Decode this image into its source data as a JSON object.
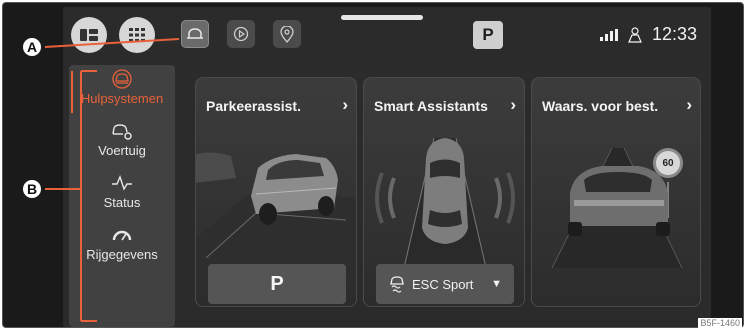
{
  "topbar": {
    "gear": "P",
    "clock": "12:33",
    "icons": [
      "display-icon",
      "grid-icon",
      "car-assist-icon",
      "media-play-icon",
      "location-pin-icon",
      "signal-icon",
      "user-icon"
    ]
  },
  "sidebar": {
    "items": [
      {
        "label": "Hulpsystemen",
        "icon": "car-front-icon",
        "active": true
      },
      {
        "label": "Voertuig",
        "icon": "car-settings-icon",
        "active": false
      },
      {
        "label": "Status",
        "icon": "pulse-icon",
        "active": false
      },
      {
        "label": "Rijgegevens",
        "icon": "gauge-icon",
        "active": false
      }
    ]
  },
  "cards": [
    {
      "title": "Parkeerassist.",
      "button": "P"
    },
    {
      "title": "Smart Assistants",
      "button": "ESC Sport"
    },
    {
      "title": "Waars. voor best.",
      "sign": "60"
    }
  ],
  "callouts": {
    "a": "A",
    "b": "B"
  },
  "figure_code": "B5F-1460",
  "colors": {
    "accent": "#e8613a",
    "background": "#2b2b2b",
    "callout": "#e8613a"
  }
}
